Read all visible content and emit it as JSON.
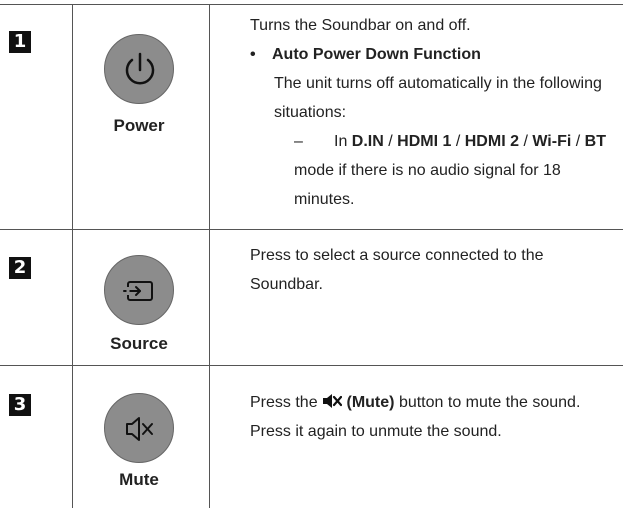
{
  "rows": [
    {
      "number": "1",
      "icon": "power-icon",
      "label": "Power",
      "intro": "Turns the Soundbar on and off.",
      "bullet_title": "Auto Power Down Function",
      "bullet_text": "The unit turns off automatically in the following situations:",
      "dash_prefix": "In",
      "modes": [
        "D.IN",
        "HDMI 1",
        "HDMI 2",
        "Wi-Fi",
        "BT"
      ],
      "separator": "/",
      "dash_suffix": "mode if there is no audio signal for 18 minutes."
    },
    {
      "number": "2",
      "icon": "source-icon",
      "label": "Source",
      "text": "Press to select a source connected to the Soundbar."
    },
    {
      "number": "3",
      "icon": "mute-icon",
      "label": "Mute",
      "line1_pre": "Press the",
      "line1_bold": "(Mute)",
      "line1_post": "button to mute the sound.",
      "line2": "Press it again to unmute the sound."
    }
  ]
}
